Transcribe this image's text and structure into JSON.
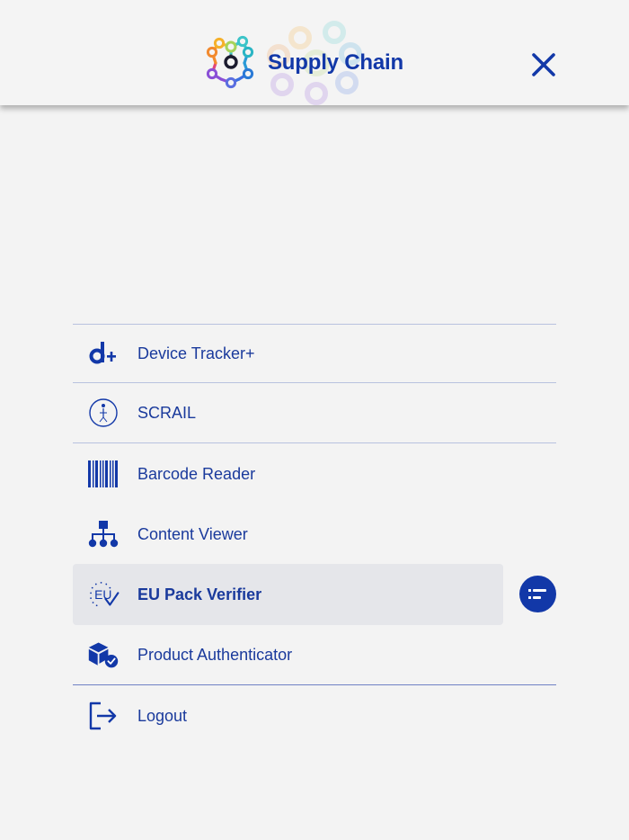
{
  "header": {
    "brand_title": "Supply Chain",
    "logo_icon": "supply-chain-hexagon-logo",
    "close_icon": "close-icon"
  },
  "menu": {
    "items": [
      {
        "label": "Device Tracker+",
        "icon": "device-tracker-icon"
      },
      {
        "label": "SCRAIL",
        "icon": "scrail-icon"
      },
      {
        "label": "Barcode Reader",
        "icon": "barcode-icon"
      },
      {
        "label": "Content Viewer",
        "icon": "hierarchy-icon"
      },
      {
        "label": "EU Pack Verifier",
        "icon": "eu-check-icon",
        "active": true
      },
      {
        "label": "Product Authenticator",
        "icon": "box-check-icon"
      }
    ],
    "logout_label": "Logout",
    "logout_icon": "logout-icon",
    "side_badge_icon": "list-filter-icon"
  },
  "colors": {
    "primary": "#1238a8",
    "background": "#f3f3f3",
    "active_row": "#e5e6ea",
    "divider": "#b8c2df"
  }
}
